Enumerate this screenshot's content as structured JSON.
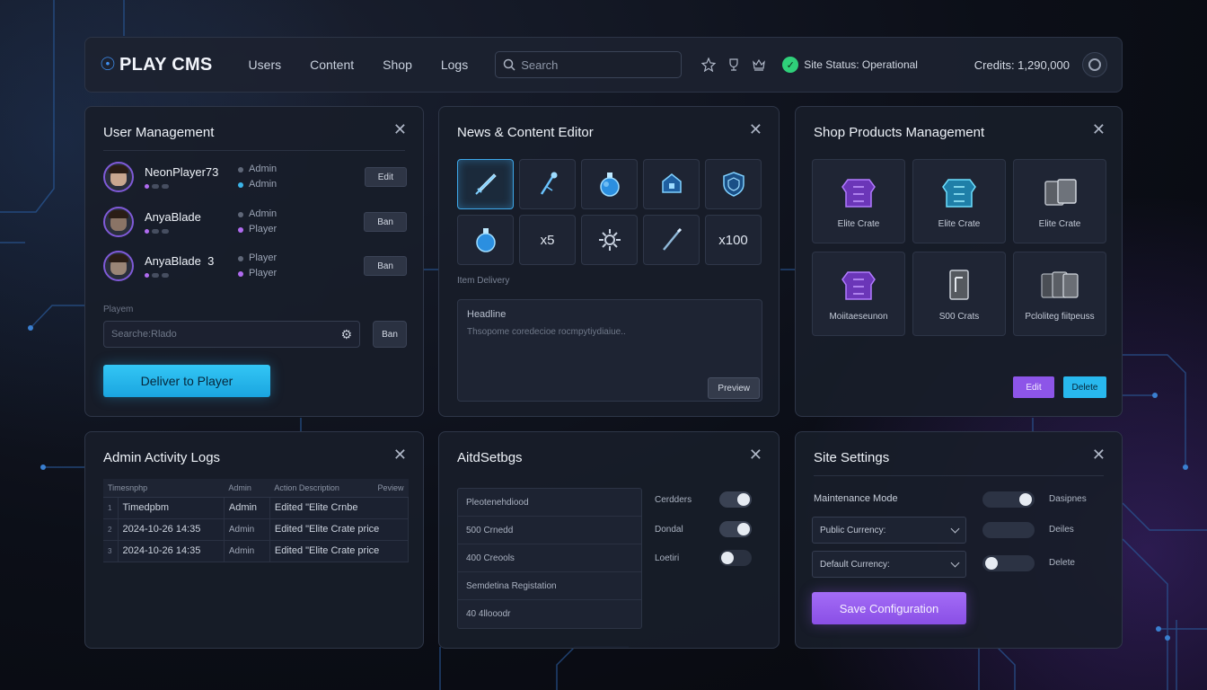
{
  "app": {
    "title": "PLAY CMS"
  },
  "nav": [
    {
      "label": "Users"
    },
    {
      "label": "Content"
    },
    {
      "label": "Shop"
    },
    {
      "label": "Logs"
    }
  ],
  "search": {
    "placeholder": "Search"
  },
  "status": {
    "text": "Site Status: Operational",
    "color": "#2fd07a"
  },
  "credits": "Credits: 1,290,000",
  "user_management": {
    "title": "User Management",
    "users": [
      {
        "name": "NeonPlayer73",
        "roles": [
          "Admin",
          "Admin"
        ],
        "role_colors": [
          "#5f6778",
          "#3bb4e8"
        ],
        "action": "Edit"
      },
      {
        "name": "AnyaBlade",
        "roles": [
          "Admin",
          "Player"
        ],
        "role_colors": [
          "#5f6778",
          "#b06bf0"
        ],
        "action": "Ban"
      },
      {
        "name": "AnyaBlade  3",
        "roles": [
          "Player",
          "Player"
        ],
        "role_colors": [
          "#5f6778",
          "#b06bf0"
        ],
        "action": "Ban"
      }
    ],
    "field_label": "Playem",
    "search_placeholder": "Searche:Rlado",
    "ban_label": "Ban",
    "deliver_label": "Deliver to Player"
  },
  "content_editor": {
    "title": "News & Content Editor",
    "items": [
      {
        "icon": "sword-icon",
        "text": ""
      },
      {
        "icon": "magic-staff-icon",
        "text": ""
      },
      {
        "icon": "potion-icon",
        "text": ""
      },
      {
        "icon": "chest-icon",
        "text": ""
      },
      {
        "icon": "shield-icon",
        "text": ""
      },
      {
        "icon": "potion-icon",
        "text": ""
      },
      {
        "icon": "",
        "text": "x5"
      },
      {
        "icon": "gear-cog-icon",
        "text": ""
      },
      {
        "icon": "wand-icon",
        "text": ""
      },
      {
        "icon": "",
        "text": "x100"
      }
    ],
    "section_label": "Item Delivery",
    "headline": "Headline",
    "body_placeholder": "Thsopome coredecioe rocmpytiydiaiue..",
    "preview_label": "Preview"
  },
  "shop": {
    "title": "Shop Products Management",
    "products": [
      {
        "label": "Elite Crate",
        "icon": "armor-purple-icon"
      },
      {
        "label": "Elite Crate",
        "icon": "armor-cyan-icon"
      },
      {
        "label": "Elite Crate",
        "icon": "crate-icon"
      },
      {
        "label": "Moiitaeseunon",
        "icon": "armor-purple-icon"
      },
      {
        "label": "S00 Crats",
        "icon": "card-icon"
      },
      {
        "label": "Pcloliteg fiitpeuss",
        "icon": "cards-icon"
      }
    ],
    "edit_label": "Edit",
    "delete_label": "Delete"
  },
  "logs": {
    "title": "Admin Activity Logs",
    "columns": [
      "Timesnphp",
      "Admin",
      "Action Description",
      "Peview"
    ],
    "rows": [
      {
        "idx": "1",
        "time": "Timedpbm",
        "admin": "Admin",
        "action": "Edited \"Elite Crnbe"
      },
      {
        "idx": "2",
        "time": "2024-10-26 14:35",
        "admin": "Admin",
        "action": "Edited \"Elite Crate price"
      },
      {
        "idx": "3",
        "time": "2024-10-26 14:35",
        "admin": "Admin",
        "action": "Edited \"Elite Crate price"
      }
    ]
  },
  "middle": {
    "title": "AitdSetbgs",
    "list": [
      "Pleotenehdiood",
      "500 Crnedd",
      "400 Creools",
      "Semdetina Registation",
      "40 4llooodr"
    ],
    "toggles": [
      {
        "label": "Cerdders",
        "on": true
      },
      {
        "label": "Dondal",
        "on": true
      },
      {
        "label": "Loetiri",
        "on": false
      }
    ]
  },
  "site_settings": {
    "title": "Site Settings",
    "maintenance_label": "Maintenance Mode",
    "public_currency": "Public Currency:",
    "default_currency": "Default Currency:",
    "side_labels": [
      "Dasipnes",
      "Deiles",
      "Delete"
    ],
    "save_label": "Save Configuration"
  },
  "colors": {
    "accent_cyan": "#28b8ee",
    "accent_purple": "#8d55e8",
    "panel_bg": "#181d29"
  }
}
